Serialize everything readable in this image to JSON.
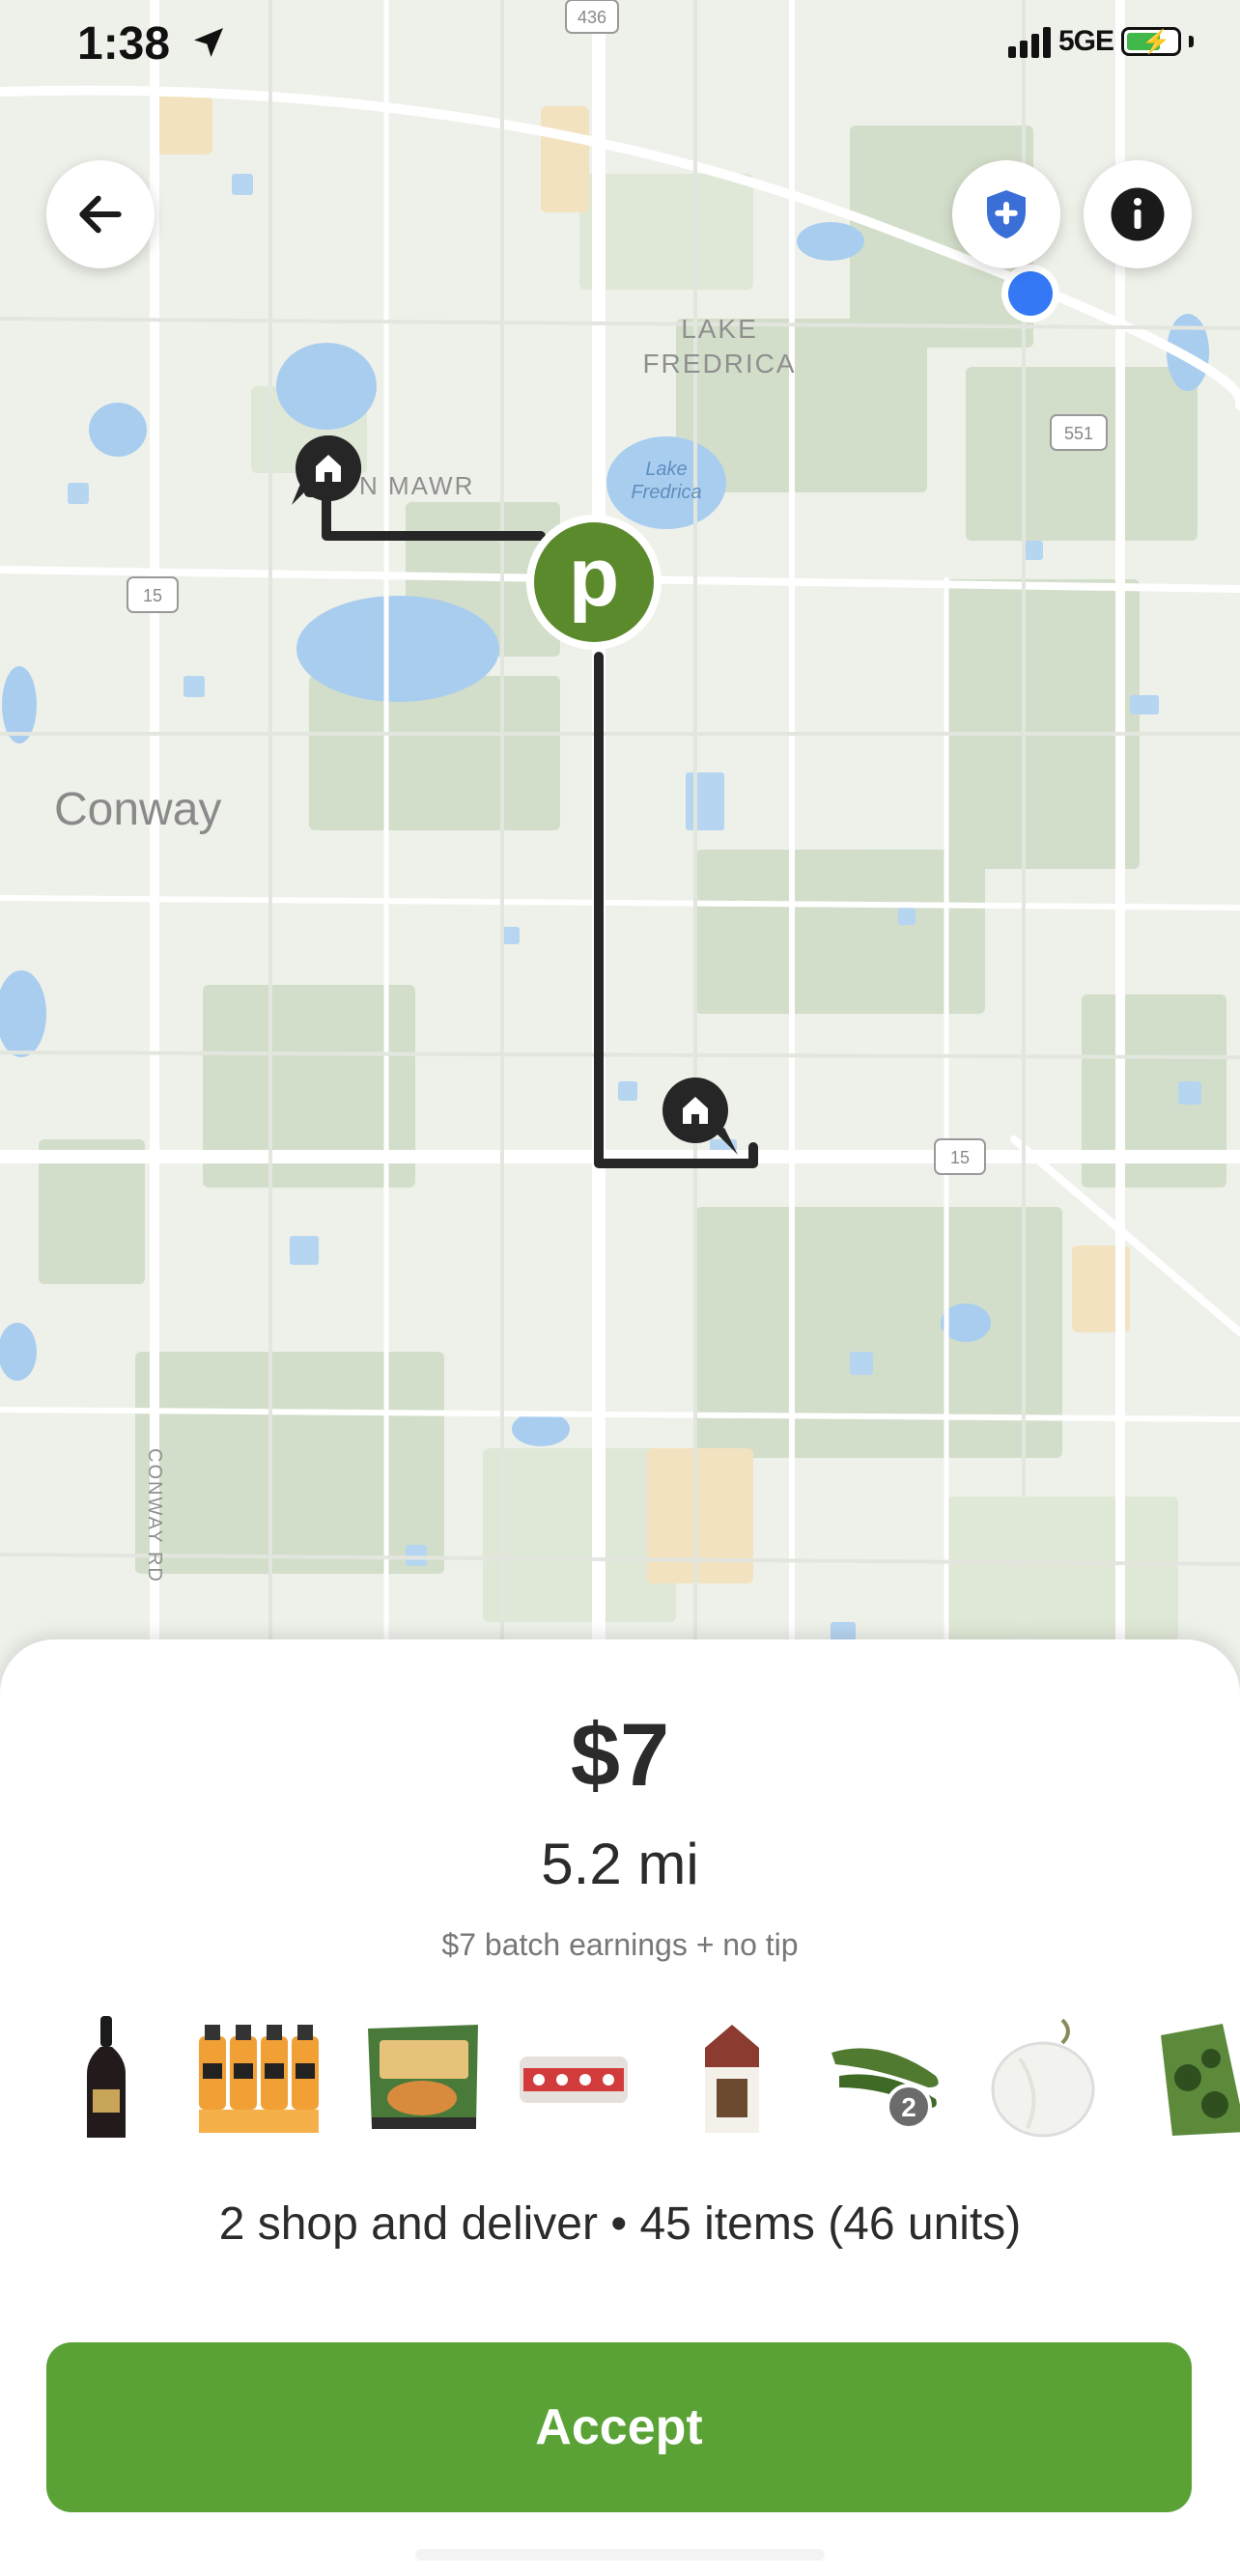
{
  "status_bar": {
    "time": "1:38",
    "network": "5GE"
  },
  "map": {
    "labels": {
      "conway": "Conway",
      "lake_fredrica_area": [
        "LAKE",
        "FREDRICA"
      ],
      "lake_fredrica_water": [
        "Lake",
        "Fredrica"
      ],
      "mawr": "N MAWR",
      "conway_rd": "CONWAY RD"
    },
    "road_shields": [
      "436",
      "551",
      "15",
      "15"
    ],
    "store_letter": "p",
    "route_color": "#262626",
    "store_color": "#5b8a2c"
  },
  "top_buttons": {
    "back_icon": "arrow-left-icon",
    "safety_icon": "shield-plus-icon",
    "info_icon": "info-icon"
  },
  "offer": {
    "price": "$7",
    "distance": "5.2 mi",
    "earnings_note": "$7 batch earnings + no tip",
    "items": [
      "wine-bottle",
      "gatorade-pack",
      "sweet-potato-chips",
      "yogurt-drinks",
      "milk-carton",
      "zucchini",
      "onion",
      "produce-bag"
    ],
    "zucchini_count": "2",
    "summary": "2 shop and deliver • 45 items (46 units)",
    "accept_label": "Accept",
    "accent": "#5aa236"
  }
}
